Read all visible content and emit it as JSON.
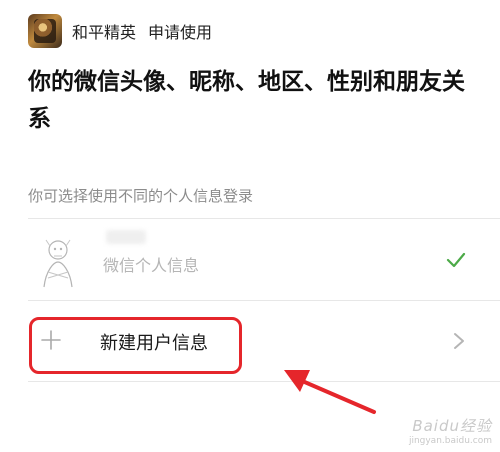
{
  "header": {
    "app_name": "和平精英",
    "action": "申请使用"
  },
  "title": "你的微信头像、昵称、地区、性别和朋友关系",
  "subtitle": "你可选择使用不同的个人信息登录",
  "options": [
    {
      "label": "微信个人信息",
      "selected": true,
      "icon": "check-icon"
    },
    {
      "label": "新建用户信息",
      "selected": false,
      "icon": "plus-icon"
    }
  ],
  "annotation": {
    "highlight_color": "#e5262b",
    "arrow_color": "#e5262b"
  },
  "watermark": {
    "main": "Baidu经验",
    "sub": "jingyan.baidu.com"
  }
}
